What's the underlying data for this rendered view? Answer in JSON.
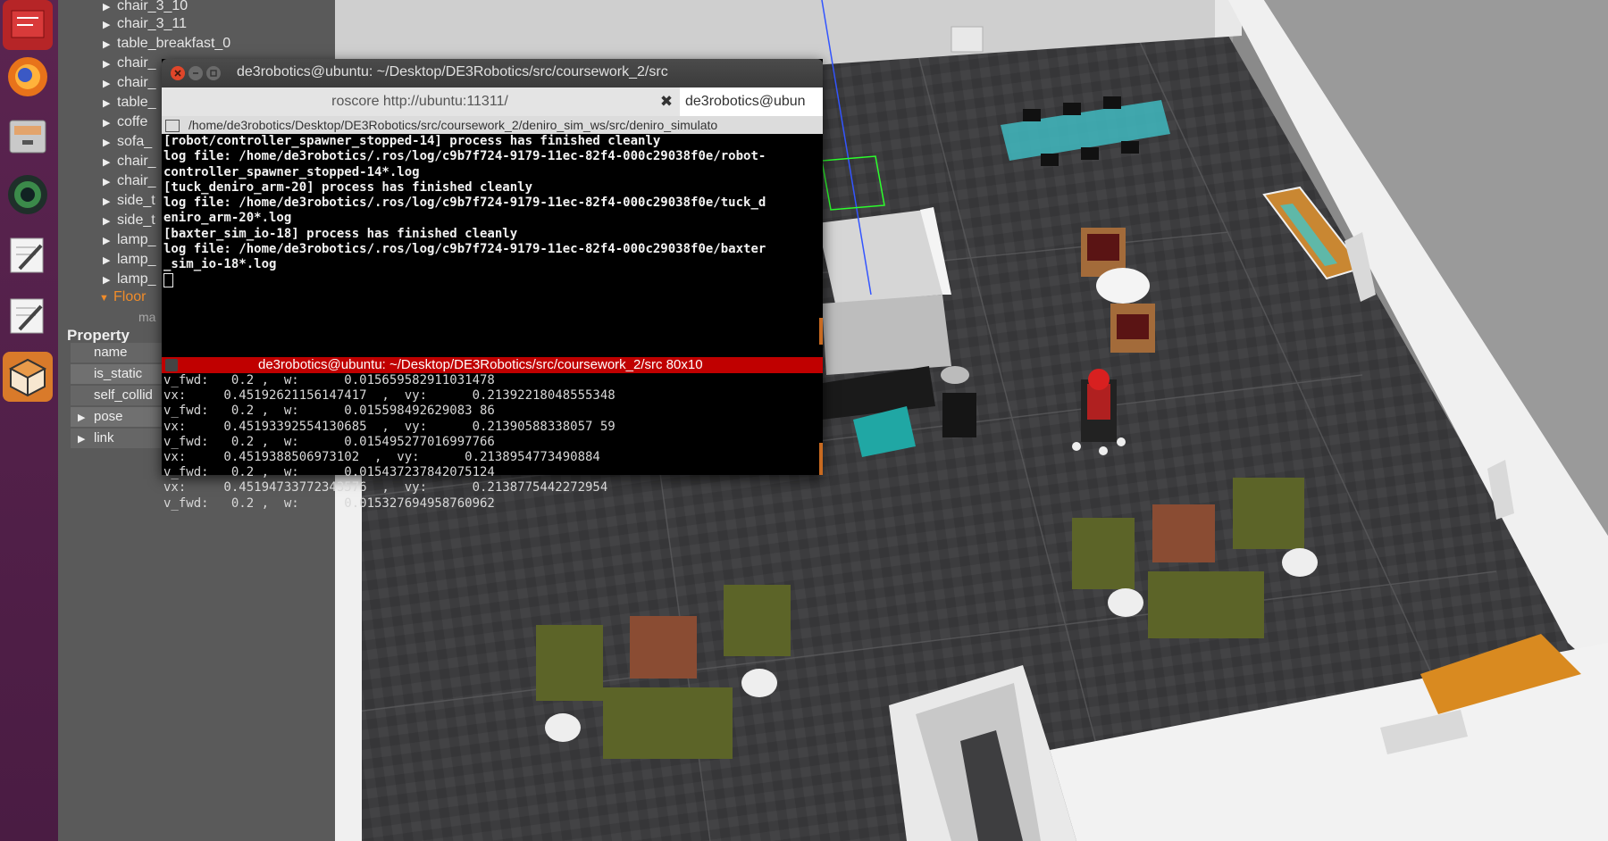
{
  "launcher": {
    "items": [
      {
        "name": "app-icon",
        "color": "#c0282a"
      },
      {
        "name": "firefox-icon",
        "color": "#e8731a"
      },
      {
        "name": "files-icon",
        "color": "#9a9a9a"
      },
      {
        "name": "camera-icon",
        "color": "#2d6b3a"
      },
      {
        "name": "text-editor-icon",
        "color": "#e8e8e8"
      },
      {
        "name": "text-editor-icon",
        "color": "#e8e8e8"
      },
      {
        "name": "gazebo-icon",
        "color": "#d97a2a"
      }
    ]
  },
  "tree": {
    "items": [
      "chair_3_10",
      "chair_3_11",
      "table_breakfast_0",
      "chair_",
      "chair_",
      "table_",
      "coffe",
      "sofa_",
      "chair_",
      "chair_",
      "side_t",
      "side_t",
      "lamp_",
      "lamp_",
      "lamp_"
    ],
    "floor": "Floor",
    "partial": "ma"
  },
  "properties": {
    "header": "Property",
    "rows": [
      "name",
      "is_static",
      "self_collid",
      "pose",
      "link"
    ]
  },
  "terminal": {
    "title": "de3robotics@ubuntu: ~/Desktop/DE3Robotics/src/coursework_2/src",
    "tab1": "roscore http://ubuntu:11311/",
    "tab2": "de3robotics@ubun",
    "path": "/home/de3robotics/Desktop/DE3Robotics/src/coursework_2/deniro_sim_ws/src/deniro_simulato",
    "upper_lines": [
      "[robot/controller_spawner_stopped-14] process has finished cleanly",
      "log file: /home/de3robotics/.ros/log/c9b7f724-9179-11ec-82f4-000c29038f0e/robot-",
      "controller_spawner_stopped-14*.log",
      "[tuck_deniro_arm-20] process has finished cleanly",
      "log file: /home/de3robotics/.ros/log/c9b7f724-9179-11ec-82f4-000c29038f0e/tuck_d",
      "eniro_arm-20*.log",
      "[baxter_sim_io-18] process has finished cleanly",
      "log file: /home/de3robotics/.ros/log/c9b7f724-9179-11ec-82f4-000c29038f0e/baxter",
      "_sim_io-18*.log"
    ],
    "lower_title": "de3robotics@ubuntu: ~/Desktop/DE3Robotics/src/coursework_2/src 80x10",
    "lower_lines": [
      "v_fwd:   0.2 ,  w:      0.015659582911031478",
      "vx:     0.45192621156147417  ,  vy:      0.21392218048555348",
      "v_fwd:   0.2 ,  w:      0.015598492629083 86",
      "vx:     0.45193392554130685  ,  vy:      0.21390588338057 59",
      "v_fwd:   0.2 ,  w:      0.015495277016997766",
      "vx:     0.4519388506973102  ,  vy:      0.2138954773490884",
      "v_fwd:   0.2 ,  w:      0.015437237842075124",
      "vx:     0.45194733772343576  ,  vy:      0.2138775442272954",
      "v_fwd:   0.2 ,  w:      0.015327694958760962"
    ]
  }
}
